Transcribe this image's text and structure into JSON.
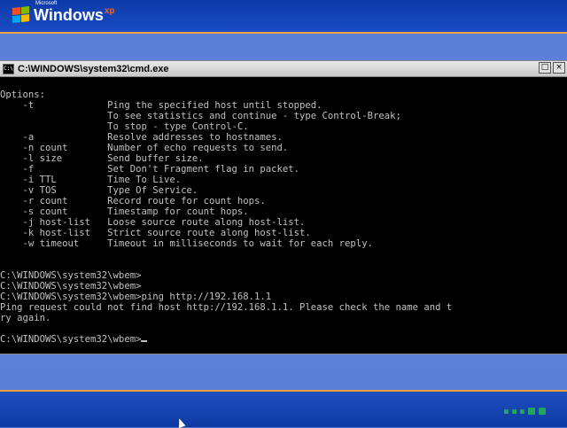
{
  "logo": {
    "small": "Microsoft",
    "name": "Windows",
    "suffix": "xp"
  },
  "window": {
    "title": "C:\\WINDOWS\\system32\\cmd.exe"
  },
  "console_lines": [
    "Options:",
    "    -t             Ping the specified host until stopped.",
    "                   To see statistics and continue - type Control-Break;",
    "                   To stop - type Control-C.",
    "    -a             Resolve addresses to hostnames.",
    "    -n count       Number of echo requests to send.",
    "    -l size        Send buffer size.",
    "    -f             Set Don't Fragment flag in packet.",
    "    -i TTL         Time To Live.",
    "    -v TOS         Type Of Service.",
    "    -r count       Record route for count hops.",
    "    -s count       Timestamp for count hops.",
    "    -j host-list   Loose source route along host-list.",
    "    -k host-list   Strict source route along host-list.",
    "    -w timeout     Timeout in milliseconds to wait for each reply.",
    "",
    "",
    "C:\\WINDOWS\\system32\\wbem>",
    "C:\\WINDOWS\\system32\\wbem>",
    "C:\\WINDOWS\\system32\\wbem>ping http://192.168.1.1",
    "Ping request could not find host http://192.168.1.1. Please check the name and t",
    "ry again.",
    ""
  ],
  "prompt": "C:\\WINDOWS\\system32\\wbem>"
}
